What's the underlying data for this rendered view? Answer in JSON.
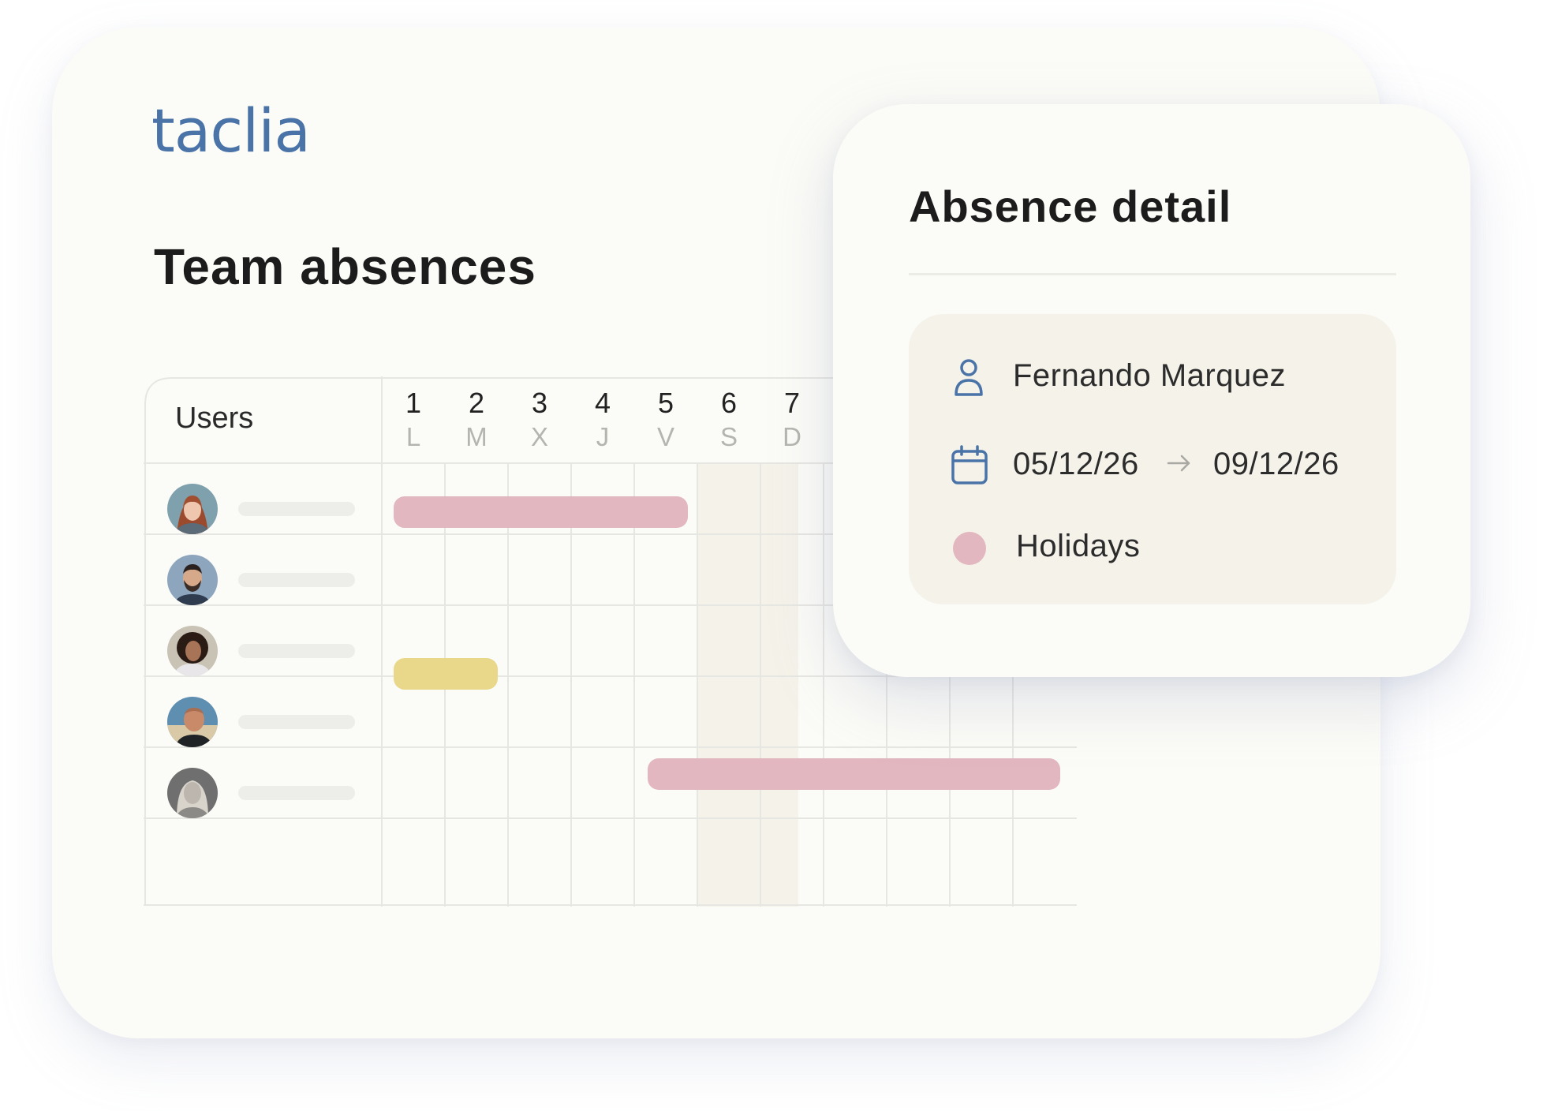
{
  "app": {
    "logo_text": "taclia"
  },
  "page": {
    "title": "Team absences"
  },
  "calendar": {
    "users_header": "Users",
    "days": [
      {
        "num": "1",
        "letter": "L"
      },
      {
        "num": "2",
        "letter": "M"
      },
      {
        "num": "3",
        "letter": "X"
      },
      {
        "num": "4",
        "letter": "J"
      },
      {
        "num": "5",
        "letter": "V"
      },
      {
        "num": "6",
        "letter": "S"
      },
      {
        "num": "7",
        "letter": "D"
      }
    ],
    "weekend_days": [
      "6",
      "7"
    ],
    "rows": [
      {
        "avatar": "woman-red-hair-avatar",
        "absences": [
          {
            "type": "Holidays",
            "from_day": 1,
            "to_day": 5
          }
        ]
      },
      {
        "avatar": "bearded-man-avatar",
        "absences": []
      },
      {
        "avatar": "curly-hair-woman-avatar",
        "absences": [
          {
            "type": "other",
            "from_day": 1,
            "to_day": 2
          }
        ]
      },
      {
        "avatar": "bald-man-avatar",
        "absences": [
          {
            "type": "Holidays",
            "from_day": 5,
            "to_day": 11
          }
        ]
      },
      {
        "avatar": "blonde-woman-avatar",
        "absences": []
      }
    ]
  },
  "absence_detail": {
    "title": "Absence detail",
    "person": "Fernando Marquez",
    "date_from": "05/12/26",
    "date_to": "09/12/26",
    "type_label": "Holidays"
  },
  "colors": {
    "brand": "#4a73a8",
    "holidays": "#e2b7c0",
    "other_absence": "#e9d88a",
    "weekend": "#f4f2e9",
    "card": "#fbfbf7"
  }
}
